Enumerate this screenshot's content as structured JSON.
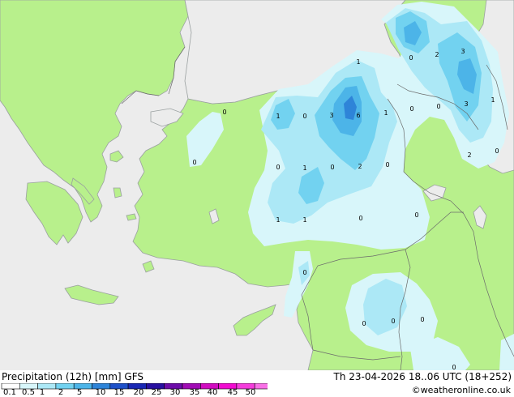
{
  "colors": {
    "sea": "#ececec",
    "land": "#b8f08c",
    "coast": "#9aa0a0",
    "border": "#6b6b6b",
    "precip": [
      "#d8f6fa",
      "#ace8f6",
      "#72d2f0",
      "#4cb4e8",
      "#2e84d8"
    ],
    "legend": [
      "#ffffff",
      "#d8f6fa",
      "#ace8f6",
      "#72d2f0",
      "#4cb4e8",
      "#2e84d8",
      "#1e50c8",
      "#1a28b4",
      "#2810a0",
      "#6c0ca8",
      "#a00cb4",
      "#d00cc0",
      "#f00cd0",
      "#f43cdc",
      "#f870e6"
    ]
  },
  "footer": {
    "title": "Precipitation (12h) [mm] GFS",
    "valid": "Th 23-04-2026 18..06 UTC (18+252)",
    "credit": "©weatheronline.co.uk"
  },
  "legend_ticks": [
    "0.1",
    "0.5",
    "1",
    "2",
    "5",
    "10",
    "15",
    "20",
    "25",
    "30",
    "35",
    "40",
    "45",
    "50"
  ],
  "map_labels": {
    "aegean_0": "0",
    "turkey_w_0": "0",
    "anatolia_1": "1",
    "anatolia_0a": "0",
    "anatolia_3": "3",
    "anatolia_6": "6",
    "anatolia_1b": "1",
    "anatolia_1c": "1",
    "black_sea_0": "0",
    "caucasus_2": "2",
    "caucasus_3": "3",
    "caucasus_3b": "3",
    "caucasus_1": "1",
    "caucasus_0": "0",
    "east_0": "0",
    "east_2": "2",
    "east_0b": "0",
    "central_0": "0",
    "central_1": "1",
    "central_0b": "0",
    "central_2": "2",
    "central_0c": "0",
    "south_1": "1",
    "south_1b": "1",
    "south_0": "0",
    "south_0b": "0",
    "levant_0": "0",
    "syria_0": "0",
    "syria_0b": "0",
    "syria_0c": "0",
    "bottom_0": "0"
  }
}
